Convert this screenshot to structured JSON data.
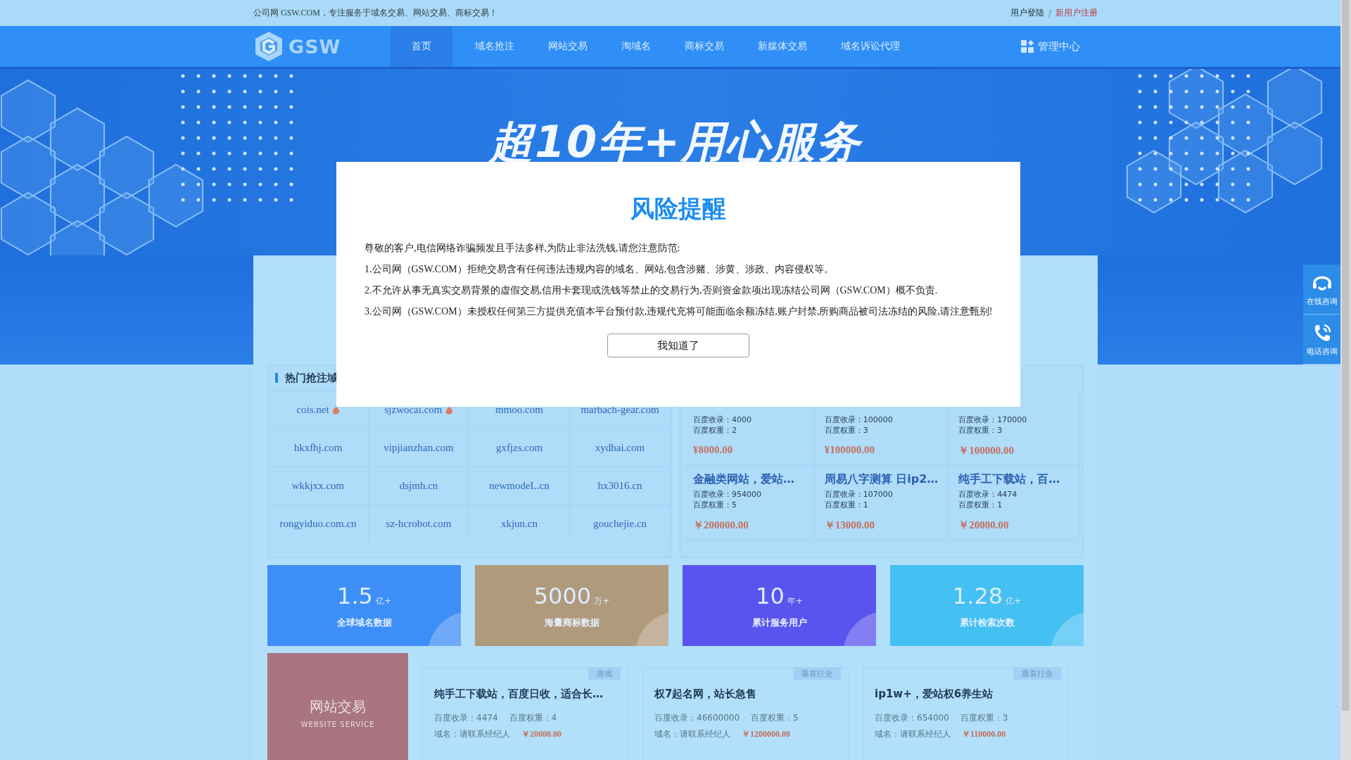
{
  "top_bar": {
    "tagline": "公司网 GSW.COM，专注服务于域名交易、网站交易、商标交易！",
    "login": "用户登陆",
    "separator": "/",
    "register": "新用户注册"
  },
  "nav": {
    "logo": "GSW",
    "items": [
      {
        "label": "首页",
        "selected": true
      },
      {
        "label": "域名抢注",
        "selected": false
      },
      {
        "label": "网站交易",
        "selected": false
      },
      {
        "label": "淘域名",
        "selected": false
      },
      {
        "label": "商标交易",
        "selected": false
      },
      {
        "label": "新媒体交易",
        "selected": false
      },
      {
        "label": "域名诉讼代理",
        "selected": false
      }
    ],
    "admin": "管理中心"
  },
  "hero": {
    "headline": "超10年+用心服务"
  },
  "modal": {
    "title": "风险提醒",
    "intro": "尊敬的客户,电信网络诈骗频发且手法多样,为防止非法洗钱,请您注意防范:",
    "rules": [
      "1.公司网（GSW.COM）拒绝交易含有任何违法违规内容的域名、网站,包含涉赌、涉黄、涉政、内容侵权等。",
      "2.不允许从事无真实交易背景的虚假交易,信用卡套现或洗钱等禁止的交易行为,否则资金款项出现冻结公司网（GSW.COM）概不负责.",
      "3.公司网（GSW.COM）未授权任何第三方提供充值本平台预付款,违规代充将可能面临余额冻结,账户封禁,所购商品被司法冻结的风险,请注意甄别!"
    ],
    "button": "我知道了"
  },
  "hot_domains": {
    "heading": "热门抢注域",
    "rows": [
      [
        {
          "name": "cois.net",
          "hot": true
        },
        {
          "name": "sjzwocai.com",
          "hot": true
        },
        {
          "name": "mmoo.com",
          "hot": false
        },
        {
          "name": "marbach-gear.com",
          "hot": false
        }
      ],
      [
        {
          "name": "hkxfhj.com",
          "hot": false
        },
        {
          "name": "vipjianzhan.com",
          "hot": false
        },
        {
          "name": "gxfjzs.com",
          "hot": false
        },
        {
          "name": "xydhai.com",
          "hot": false
        }
      ],
      [
        {
          "name": "wkkjxx.com",
          "hot": false
        },
        {
          "name": "dsjmh.cn",
          "hot": false
        },
        {
          "name": "newmodeL.cn",
          "hot": false
        },
        {
          "name": "hx3016.cn",
          "hot": false
        }
      ],
      [
        {
          "name": "rongyiduo.com.cn",
          "hot": false
        },
        {
          "name": "sz-hcrobot.com",
          "hot": false
        },
        {
          "name": "xkjun.cn",
          "hot": false
        },
        {
          "name": "gouchejie.cn",
          "hot": false
        }
      ]
    ]
  },
  "featured_sites": [
    {
      "indexed": "百度收录：4000",
      "weight": "百度权重：2",
      "price": "¥8000.00"
    },
    {
      "indexed": "百度收录：100000",
      "weight": "百度权重：3",
      "price": "¥100000.00"
    },
    {
      "indexed": "百度收录：170000",
      "weight": "百度权重：3",
      "price": "￥100000.00"
    },
    {
      "title": "金融类网站，爱站…",
      "indexed": "百度收录：954000",
      "weight": "百度权重：5",
      "price": "￥200000.00"
    },
    {
      "title": "周易八字测算 日ip2…",
      "indexed": "百度收录：107000",
      "weight": "百度权重：1",
      "price": "￥13000.00"
    },
    {
      "title": "纯手工下载站，百…",
      "indexed": "百度收录：4474",
      "weight": "百度权重：1",
      "price": "￥20000.00"
    }
  ],
  "stats": [
    {
      "number": "1.5",
      "unit": "亿+",
      "label": "全球域名数据",
      "color": "#3d8ef7"
    },
    {
      "number": "5000",
      "unit": "万+",
      "label": "海量商标数据",
      "color": "#b09a7c"
    },
    {
      "number": "10",
      "unit": "年+",
      "label": "累计服务用户",
      "color": "#5a54ee"
    },
    {
      "number": "1.28",
      "unit": "亿+",
      "label": "累计检索次数",
      "color": "#45c0f2"
    }
  ],
  "website_trade": {
    "title": "网站交易",
    "subtitle": "WEBSITE SERVICE",
    "listings": [
      {
        "tag": "游戏",
        "title": "纯手工下载站，百度日收，适合长…",
        "indexed": "百度收录：4474",
        "weight": "百度权重：4",
        "domain": "域名：请联系经纪人",
        "price": "￥20000.00"
      },
      {
        "tag": "垂直行业",
        "title": "权7起名网，站长急售",
        "indexed": "百度收录：46600000",
        "weight": "百度权重：5",
        "domain": "域名：请联系经纪人",
        "price": "￥1200000.00"
      },
      {
        "tag": "垂直行业",
        "title": "ip1w+，爱站权6养生站",
        "indexed": "百度收录：654000",
        "weight": "百度权重：3",
        "domain": "域名：请联系经纪人",
        "price": "￥110000.00"
      }
    ]
  },
  "side_panel": [
    {
      "kind": "headset",
      "label": "在线咨询"
    },
    {
      "kind": "phone",
      "label": "电话咨询"
    }
  ]
}
